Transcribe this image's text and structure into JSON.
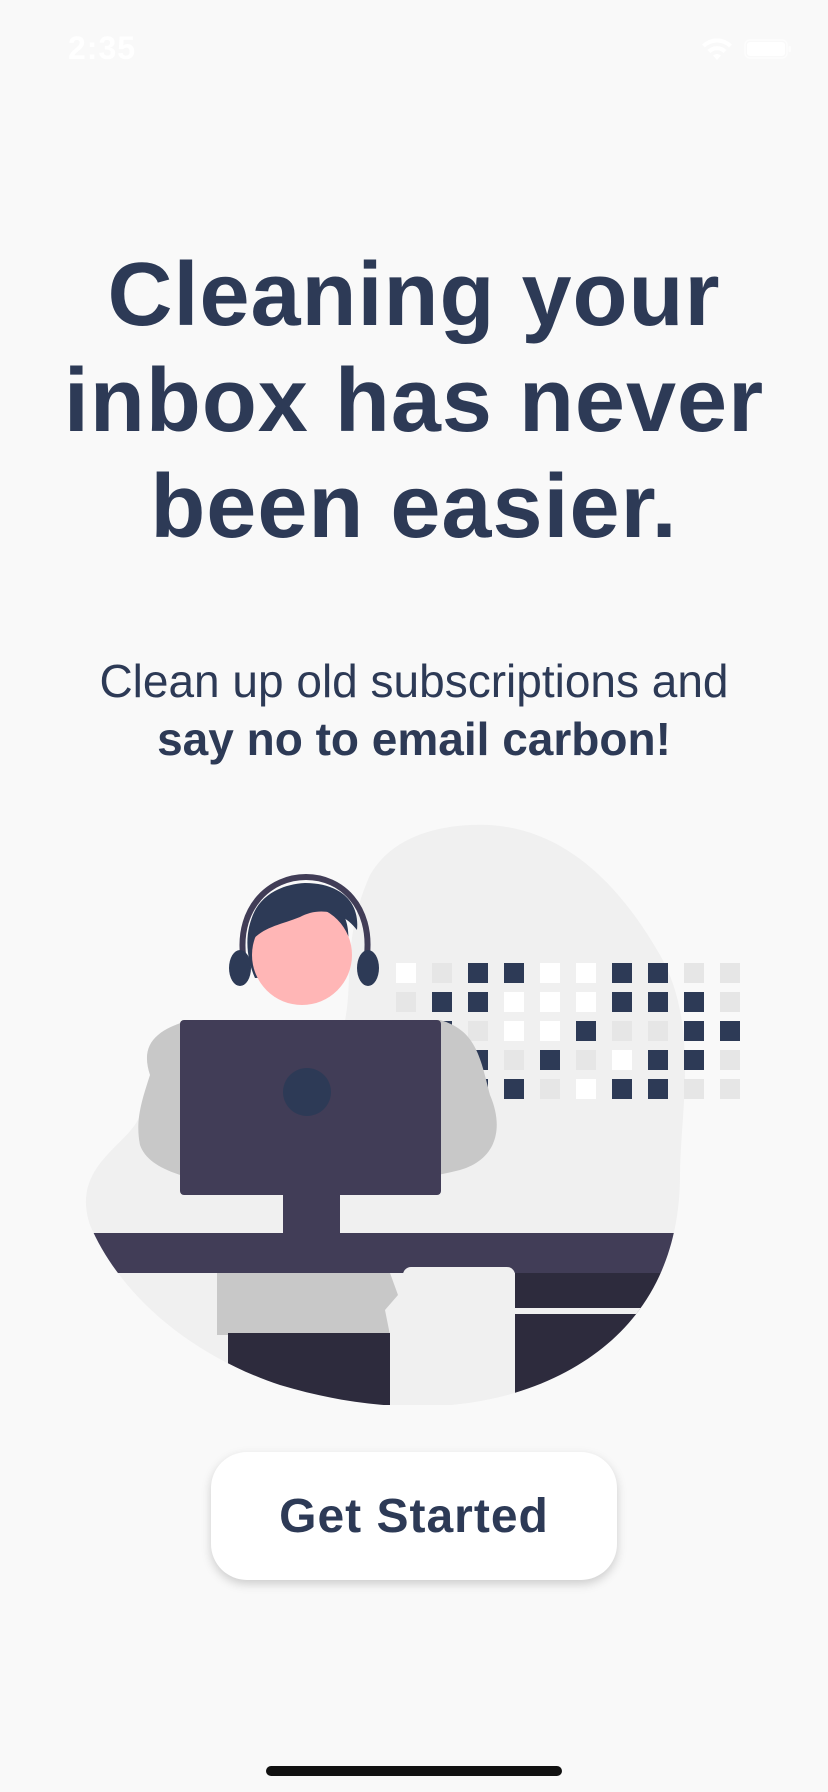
{
  "status_bar": {
    "time": "2:35",
    "wifi_icon": "wifi-icon",
    "battery_icon": "battery-icon"
  },
  "hero": {
    "title_line1": "Cleaning your",
    "title_line2": "inbox has never",
    "title_line3": "been easier.",
    "subtitle_regular": "Clean up old subscriptions and",
    "subtitle_bold": "say no to email carbon!"
  },
  "illustration": {
    "name": "person-at-computer-illustration",
    "colors": {
      "navy": "#2d3a56",
      "dark_purple": "#413d57",
      "skin": "#ffb6b6",
      "gray": "#c8c8c8",
      "light_gray": "#f0f0f0"
    }
  },
  "actions": {
    "get_started_label": "Get Started"
  },
  "colors": {
    "background": "#f9f9f9",
    "text": "#2d3a56",
    "button_bg": "#ffffff"
  }
}
